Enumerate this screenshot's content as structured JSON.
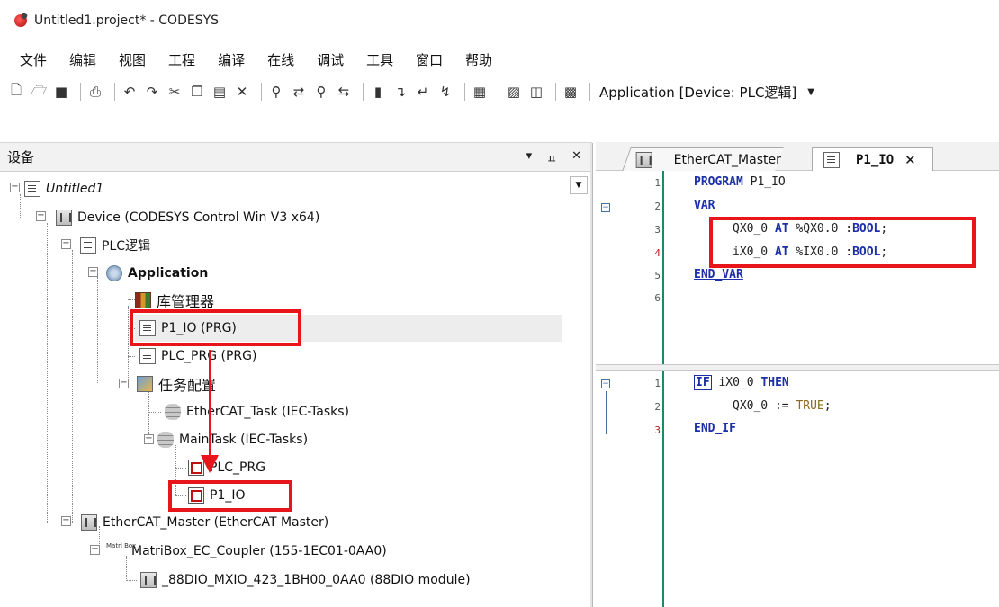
{
  "window": {
    "title": "Untitled1.project* - CODESYS"
  },
  "menu": [
    "文件",
    "编辑",
    "视图",
    "工程",
    "编译",
    "在线",
    "调试",
    "工具",
    "窗口",
    "帮助"
  ],
  "toolbar": {
    "application_label": "Application [Device: PLC逻辑]"
  },
  "devices_panel": {
    "title": "设备",
    "buttons": {
      "dropdown": "▾",
      "pin": "ㅍ",
      "close": "✕"
    },
    "tree": {
      "project": "Untitled1",
      "device": "Device (CODESYS Control Win V3 x64)",
      "plc_logic": "PLC逻辑",
      "application": "Application",
      "library_manager": "库管理器",
      "p1_io": "P1_IO (PRG)",
      "plc_prg": "PLC_PRG (PRG)",
      "task_config": "任务配置",
      "ethercat_task": "EtherCAT_Task (IEC-Tasks)",
      "main_task": "MainTask (IEC-Tasks)",
      "main_task_plc_prg": "PLC_PRG",
      "main_task_p1_io": "P1_IO",
      "ethercat_master": "EtherCAT_Master (EtherCAT Master)",
      "coupler": "MatriBox_EC_Coupler (155-1EC01-0AA0)",
      "coupler_icon_text": "Matri Box",
      "module": "_88DIO_MXIO_423_1BH00_0AA0 (88DIO module)"
    }
  },
  "editor": {
    "tabs": [
      {
        "label": "EtherCAT_Master",
        "active": false
      },
      {
        "label": "P1_IO",
        "active": true,
        "close": "✕"
      }
    ],
    "declaration": {
      "line_numbers": [
        "1",
        "2",
        "3",
        "4",
        "5",
        "6"
      ],
      "l1_kw": "PROGRAM",
      "l1_name": " P1_IO",
      "l2_kw": "VAR",
      "l3_var": "QX0_0 ",
      "l3_at": "AT",
      "l3_addr": " %QX0.0 :",
      "l3_type": "BOOL",
      "l3_end": ";",
      "l4_var": "iX0_0 ",
      "l4_at": "AT",
      "l4_addr": " %IX0.0 :",
      "l4_type": "BOOL",
      "l4_end": ";",
      "l5_kw": "END_VAR"
    },
    "implementation": {
      "line_numbers": [
        "1",
        "2",
        "3"
      ],
      "l1_if": "IF",
      "l1_var": " iX0_0 ",
      "l1_then": "THEN",
      "l2_var": "QX0_0 := ",
      "l2_val": "TRUE",
      "l2_end": ";",
      "l3_kw": "END_IF"
    }
  },
  "colors": {
    "highlight": "#e8151b",
    "keyword": "#1c2ea8",
    "gutter_line": "#1b8a6b"
  }
}
